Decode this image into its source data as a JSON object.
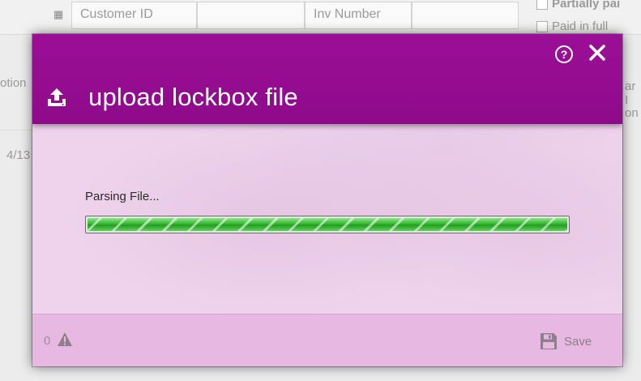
{
  "background": {
    "customer_id_placeholder": "Customer ID",
    "inv_number_placeholder": "Inv Number",
    "partially_paid_label": "Partially pai",
    "paid_in_full_label": "Paid in full",
    "left_column_fragment": "otion",
    "left_date_fragment": "4/13",
    "right_fragment_1": "ar I",
    "right_fragment_2": "on"
  },
  "dialog": {
    "title": "upload lockbox file",
    "help_glyph": "?",
    "status_text": "Parsing File...",
    "progress_fraction": 1.0,
    "warning_count": "0",
    "save_label": "Save"
  },
  "colors": {
    "header": "#960f92",
    "body": "#efd3ec",
    "footer": "#e6b8e2",
    "progress": "#33b82e"
  },
  "icons": {
    "upload": "upload-icon",
    "help": "help-icon",
    "close": "close-icon",
    "warning": "warning-icon",
    "save": "floppy-disk-icon",
    "grid": "grid-icon"
  }
}
